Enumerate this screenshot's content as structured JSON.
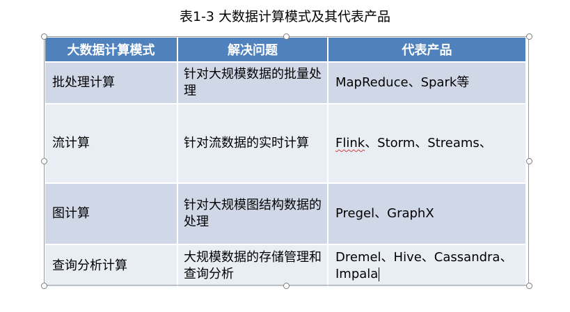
{
  "caption": "表1-3 大数据计算模式及其代表产品",
  "table": {
    "headers": [
      "大数据计算模式",
      "解决问题",
      "代表产品"
    ],
    "rows": [
      {
        "mode": "批处理计算",
        "problem": "针对大规模数据的批量处理",
        "product": "MapReduce、Spark等"
      },
      {
        "mode": "流计算",
        "problem": "针对流数据的实时计算",
        "product_prefix": "Flink",
        "product": "、Storm、Streams、"
      },
      {
        "mode": "图计算",
        "problem": "针对大规模图结构数据的处理",
        "product": "Pregel、GraphX"
      },
      {
        "mode": "查询分析计算",
        "problem": "大规模数据的存储管理和查询分析",
        "product": "Dremel、Hive、Cassandra、Impala"
      }
    ]
  },
  "colors": {
    "header_bg": "#4f81bd",
    "row_odd_bg": "#d0d8e8",
    "row_even_bg": "#e9edf4",
    "spellcheck": "#d04040"
  }
}
